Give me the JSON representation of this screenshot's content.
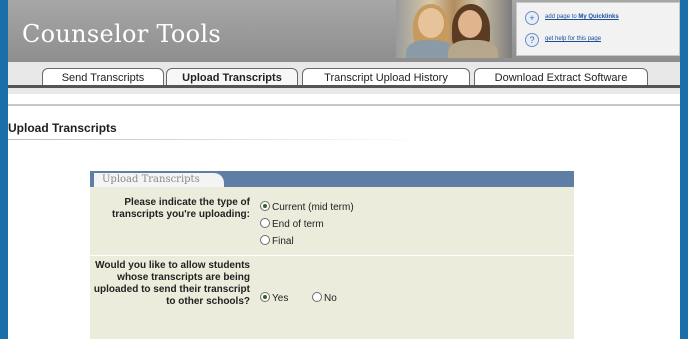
{
  "header": {
    "brand": "Counselor Tools",
    "links": [
      {
        "prefix": "add page to ",
        "bold": "My Quicklinks",
        "icon": "plus-icon"
      },
      {
        "prefix": "get help for this page",
        "bold": "",
        "icon": "help-icon"
      }
    ]
  },
  "tabs": [
    {
      "label": "Send Transcripts",
      "active": false
    },
    {
      "label": "Upload Transcripts",
      "active": true
    },
    {
      "label": "Transcript Upload History",
      "active": false
    },
    {
      "label": "Download Extract Software",
      "active": false
    }
  ],
  "page": {
    "title": "Upload Transcripts"
  },
  "panel": {
    "tab_label": "Upload Transcripts",
    "q1": {
      "label": "Please indicate the type of transcripts you're uploading:",
      "options": [
        {
          "label": "Current (mid term)",
          "selected": true
        },
        {
          "label": "End of term",
          "selected": false
        },
        {
          "label": "Final",
          "selected": false
        }
      ]
    },
    "q2": {
      "label": "Would you like to allow students whose transcripts are being uploaded to send their transcript to other schools?",
      "options": [
        {
          "label": "Yes",
          "selected": true
        },
        {
          "label": "No",
          "selected": false
        }
      ]
    }
  }
}
